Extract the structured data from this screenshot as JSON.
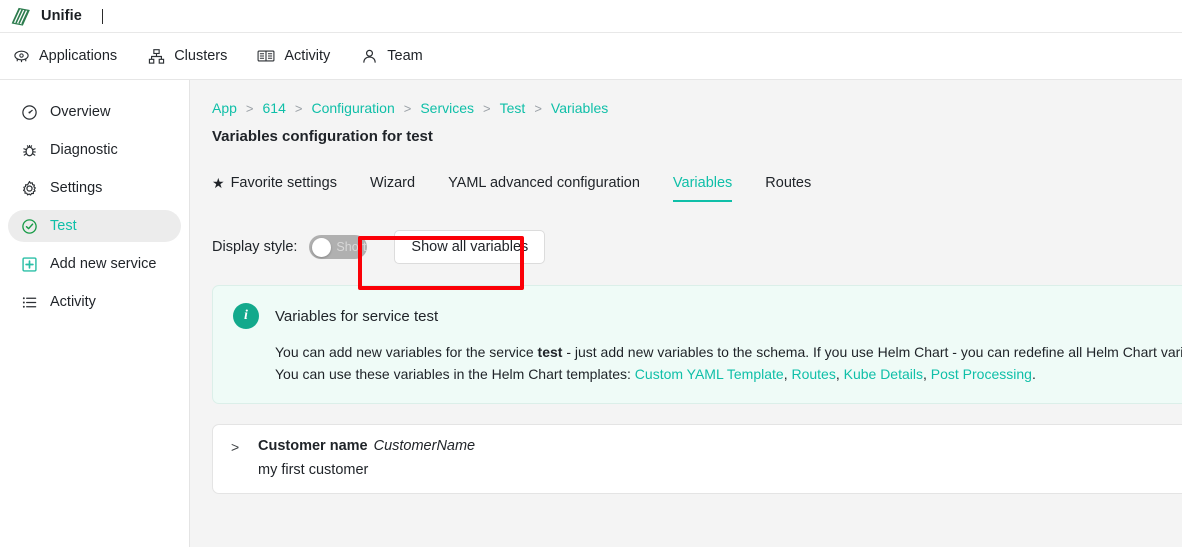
{
  "titlebar": {
    "brand": "Unifie",
    "logo_icon": "unifie-logo-icon"
  },
  "topnav": {
    "items": [
      {
        "label": "Applications",
        "icon": "applications-icon"
      },
      {
        "label": "Clusters",
        "icon": "clusters-icon"
      },
      {
        "label": "Activity",
        "icon": "activity-book-icon"
      },
      {
        "label": "Team",
        "icon": "team-person-icon"
      }
    ]
  },
  "sidebar": {
    "items": [
      {
        "label": "Overview",
        "icon": "gauge-icon",
        "selected": false
      },
      {
        "label": "Diagnostic",
        "icon": "bug-icon",
        "selected": false
      },
      {
        "label": "Settings",
        "icon": "gear-icon",
        "selected": false
      },
      {
        "label": "Test",
        "icon": "check-circle-icon",
        "selected": true
      },
      {
        "label": "Add new service",
        "icon": "plus-square-icon",
        "selected": false
      },
      {
        "label": "Activity",
        "icon": "list-icon",
        "selected": false
      }
    ]
  },
  "breadcrumb": {
    "items": [
      "App",
      "614",
      "Configuration",
      "Services",
      "Test",
      "Variables"
    ],
    "separator": ">"
  },
  "page_title": "Variables configuration for test",
  "tabs": [
    {
      "label": "Favorite settings",
      "icon": "star-icon",
      "active": false
    },
    {
      "label": "Wizard",
      "active": false
    },
    {
      "label": "YAML advanced configuration",
      "active": false
    },
    {
      "label": "Variables",
      "active": true
    },
    {
      "label": "Routes",
      "active": false
    }
  ],
  "controls": {
    "display_style_label": "Display style:",
    "toggle": {
      "label": "Short",
      "state": "off"
    },
    "show_all_button": "Show all variables"
  },
  "info_panel": {
    "badge_icon": "info-icon",
    "badge_glyph": "i",
    "title": "Variables for service test",
    "line1_part1": "You can add new variables for the service ",
    "line1_bold": "test",
    "line1_part2": " - just add new variables to the schema. If you use Helm Chart - you can redefine all Helm Chart variab",
    "line2_prefix": "You can use these variables in the Helm Chart templates: ",
    "links": [
      "Custom YAML Template",
      "Routes",
      "Kube Details",
      "Post Processing"
    ],
    "line2_suffix": "."
  },
  "variables": [
    {
      "chevron": ">",
      "name": "Customer name",
      "key": "CustomerName",
      "value": "my first customer"
    }
  ],
  "colors": {
    "accent_teal": "#0fbfa8",
    "info_badge_teal": "#13a98c",
    "info_bg": "#effbf7",
    "content_bg": "#f4f4f4",
    "highlight_red": "#fb0007",
    "selected_sidebar_bg": "#ececec",
    "logo_green": "#2e7d4f"
  }
}
